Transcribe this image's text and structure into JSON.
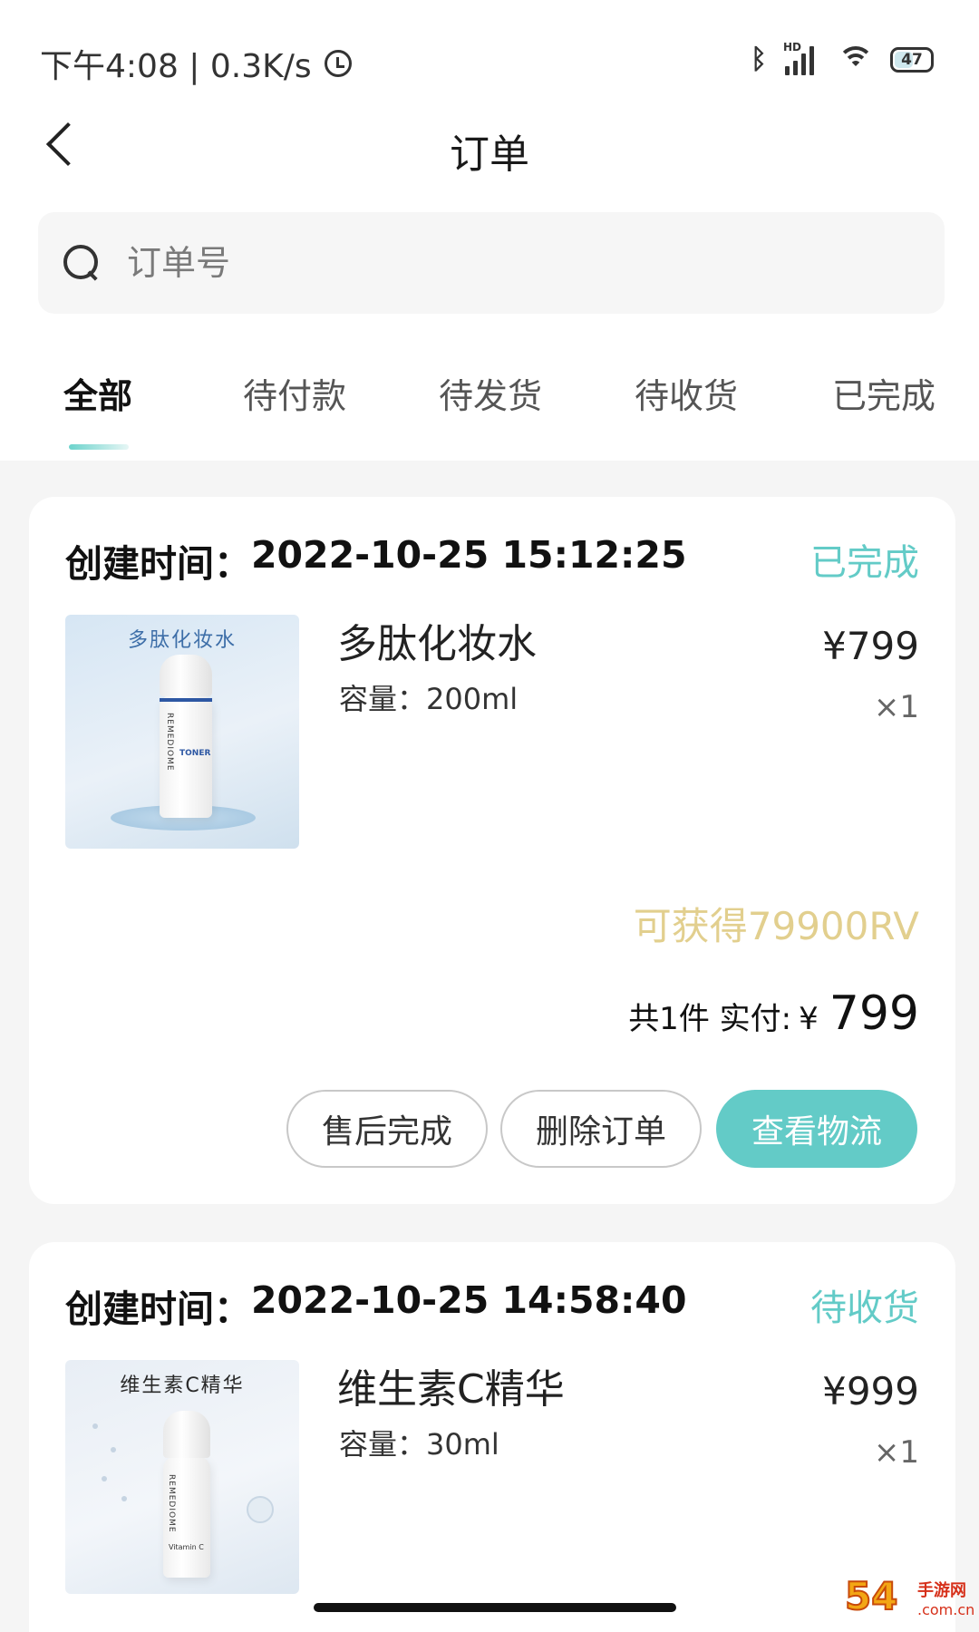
{
  "status_bar": {
    "time_speed": "下午4:08 | 0.3K/s",
    "battery": "47",
    "signal_label": "HD"
  },
  "header": {
    "title": "订单"
  },
  "search": {
    "placeholder": "订单号",
    "value": ""
  },
  "tabs": [
    {
      "label": "全部",
      "active": true
    },
    {
      "label": "待付款",
      "active": false
    },
    {
      "label": "待发货",
      "active": false
    },
    {
      "label": "待收货",
      "active": false
    },
    {
      "label": "已完成",
      "active": false
    }
  ],
  "orders": [
    {
      "created_label": "创建时间：",
      "created_time": "2022-10-25 15:12:25",
      "status": "已完成",
      "product": {
        "image_caption": "多肽化妆水",
        "bottle_brand": "REMEDIOME",
        "bottle_label": "TONER",
        "name": "多肽化妆水",
        "spec": "容量：200ml",
        "price": "¥799",
        "qty": "×1"
      },
      "reward": "可获得79900RV",
      "total_label": "共1件 实付:",
      "total_currency": "¥",
      "total_value": "799",
      "buttons": [
        "售后完成",
        "删除订单",
        "查看物流"
      ]
    },
    {
      "created_label": "创建时间：",
      "created_time": "2022-10-25 14:58:40",
      "status": "待收货",
      "product": {
        "image_caption": "维生素C精华",
        "bottle_brand": "REMEDIOME",
        "bottle_label": "Vitamin C",
        "name": "维生素C精华",
        "spec": "容量：30ml",
        "price": "¥999",
        "qty": "×1"
      }
    }
  ],
  "watermark": {
    "num": "54",
    "line1": "手游网",
    "line2": ".com.cn"
  },
  "colors": {
    "accent": "#63cbc7",
    "reward": "#e2cf8e",
    "background": "#f5f5f5"
  }
}
